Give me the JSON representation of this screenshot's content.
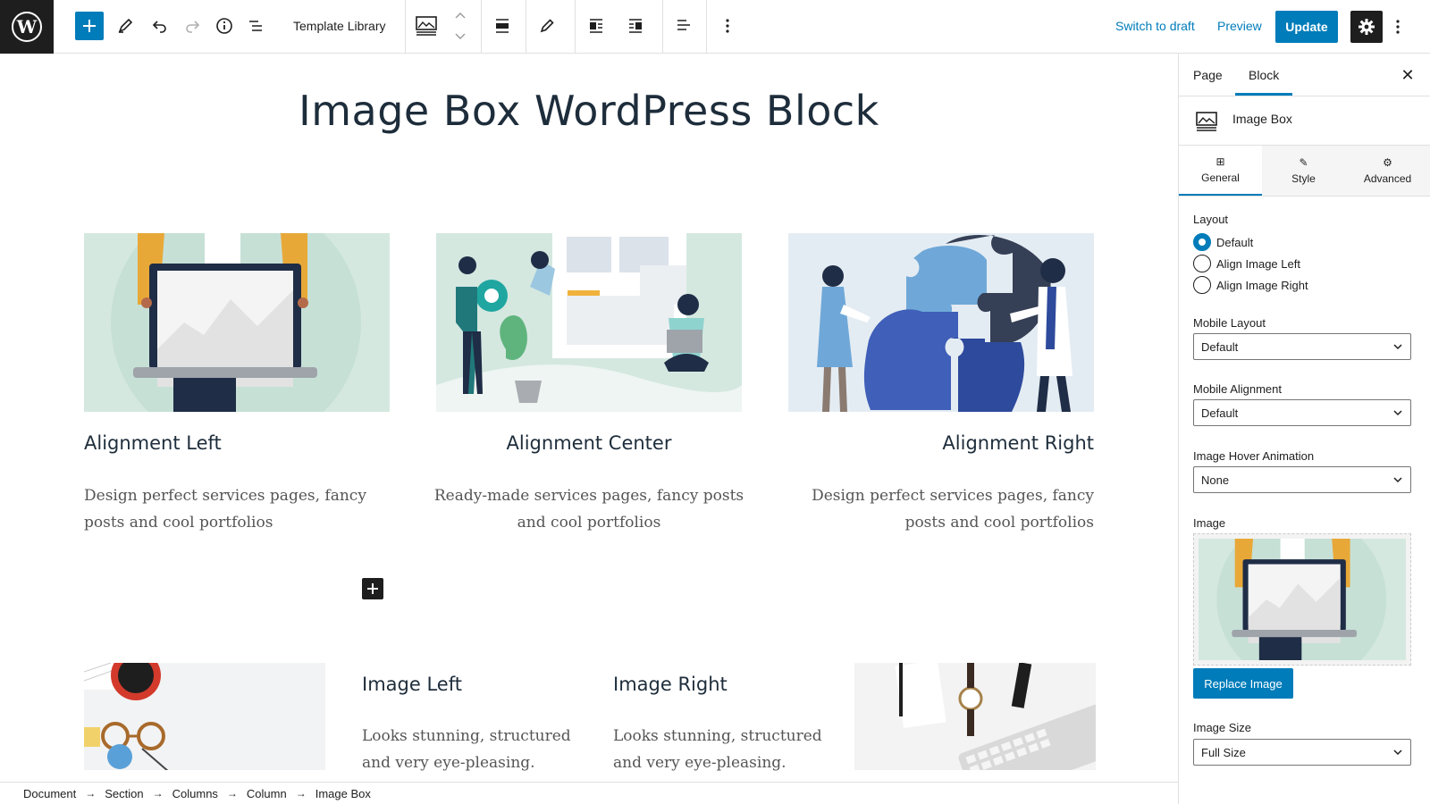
{
  "toolbar": {
    "template_library": "Template Library",
    "switch_to_draft": "Switch to draft",
    "preview": "Preview",
    "update": "Update"
  },
  "page": {
    "title": "Image Box WordPress Block"
  },
  "boxes": [
    {
      "title": "Alignment Left",
      "desc_line1": "Design perfect services pages, fancy",
      "desc_line2": "posts and cool portfolios"
    },
    {
      "title": "Alignment Center",
      "desc_line1": "Ready-made services pages, fancy posts",
      "desc_line2": "and cool portfolios"
    },
    {
      "title": "Alignment Right",
      "desc_line1": "Design perfect services pages, fancy",
      "desc_line2": "posts and cool portfolios"
    }
  ],
  "lower": [
    {
      "title": "Image Left",
      "desc_line1": "Looks stunning, structured",
      "desc_line2": "and very eye-pleasing."
    },
    {
      "title": "Image Right",
      "desc_line1": "Looks stunning, structured",
      "desc_line2": "and very eye-pleasing."
    }
  ],
  "breadcrumb": [
    "Document",
    "Section",
    "Columns",
    "Column",
    "Image Box"
  ],
  "sidebar": {
    "tab_page": "Page",
    "tab_block": "Block",
    "block_name": "Image Box",
    "sub_tabs": [
      "General",
      "Style",
      "Advanced"
    ],
    "layout_label": "Layout",
    "layout_options": [
      "Default",
      "Align Image Left",
      "Align Image Right"
    ],
    "layout_selected": "Default",
    "mobile_layout_label": "Mobile Layout",
    "mobile_layout_value": "Default",
    "mobile_alignment_label": "Mobile Alignment",
    "mobile_alignment_value": "Default",
    "hover_label": "Image Hover Animation",
    "hover_value": "None",
    "image_label": "Image",
    "replace_image": "Replace Image",
    "image_size_label": "Image Size",
    "image_size_value": "Full Size"
  },
  "colors": {
    "accent": "#007cba",
    "dark": "#1e1e1e",
    "heading": "#1e2d3b",
    "illustration_bg": "#d4e8e0",
    "puzzle_bg": "#e4ecf3"
  }
}
